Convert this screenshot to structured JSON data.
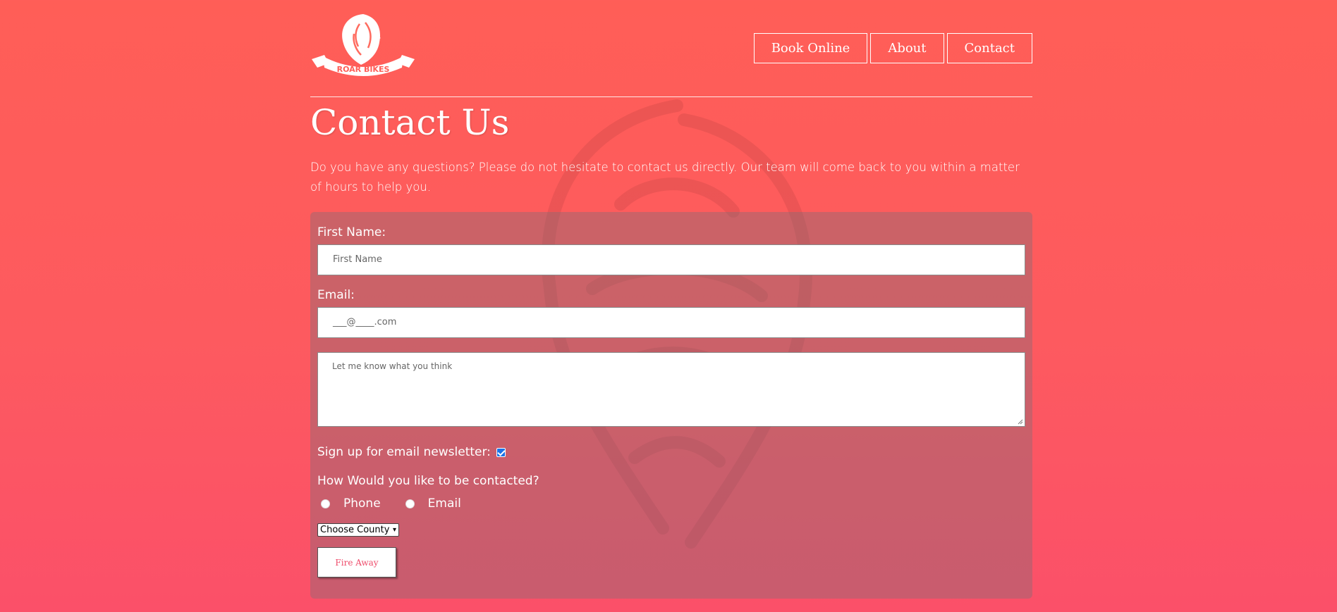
{
  "brand": {
    "logo_alt": "ROAR BIKES",
    "logo_text": "ROAR BIKES"
  },
  "nav": {
    "items": [
      {
        "label": "Book Online"
      },
      {
        "label": "About"
      },
      {
        "label": "Contact"
      }
    ]
  },
  "page": {
    "title": "Contact Us",
    "intro": "Do you have any questions? Please do not hesitate to contact us directly. Our team will come back to you within a matter of hours to help you."
  },
  "form": {
    "first_name_label": "First Name:",
    "first_name_placeholder": "First Name",
    "email_label": "Email:",
    "email_placeholder": "___@____.com",
    "message_placeholder": "Let me know what you think",
    "newsletter_label": "Sign up for email newsletter:",
    "newsletter_checked": true,
    "contact_question": "How Would you like to be contacted?",
    "contact_options": [
      {
        "label": "Phone"
      },
      {
        "label": "Email"
      }
    ],
    "county_select": "Choose County",
    "submit_label": "Fire Away"
  },
  "colors": {
    "background_top": "#ff5e57",
    "background_bottom": "#fb5069",
    "submit_text": "#ee4b6a"
  }
}
